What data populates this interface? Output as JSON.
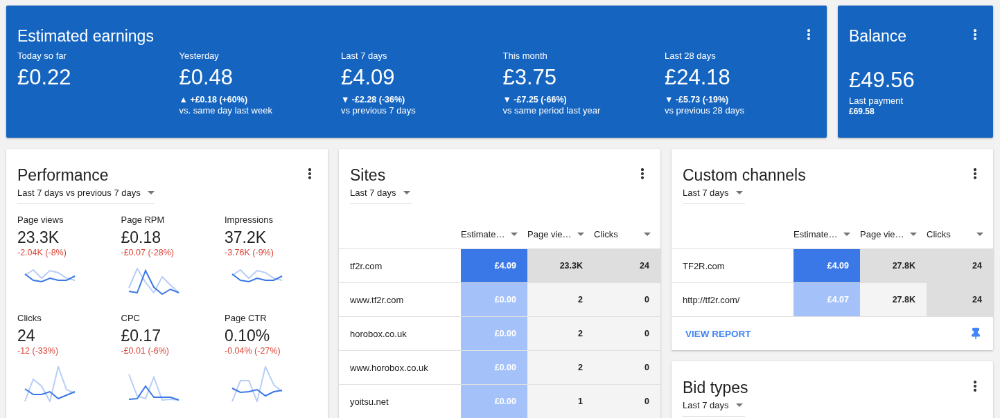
{
  "earnings": {
    "title": "Estimated earnings",
    "stats": [
      {
        "label": "Today so far",
        "value": "£0.22"
      },
      {
        "label": "Yesterday",
        "value": "£0.48",
        "change": "▲ +£0.18 (+60%)",
        "comparison": "vs. same day last week"
      },
      {
        "label": "Last 7 days",
        "value": "£4.09",
        "change": "▼ -£2.28 (-36%)",
        "comparison": "vs previous 7 days"
      },
      {
        "label": "This month",
        "value": "£3.75",
        "change": "▼ -£7.25 (-66%)",
        "comparison": "vs same period last year"
      },
      {
        "label": "Last 28 days",
        "value": "£24.18",
        "change": "▼ -£5.73 (-19%)",
        "comparison": "vs previous 28 days"
      }
    ]
  },
  "balance": {
    "title": "Balance",
    "value": "£49.56",
    "last_payment_label": "Last payment",
    "last_payment": "£69.58"
  },
  "performance": {
    "title": "Performance",
    "period": "Last 7 days vs previous 7 days",
    "metrics": [
      {
        "label": "Page views",
        "value": "23.3K",
        "change": "-2.04K (-8%)"
      },
      {
        "label": "Page RPM",
        "value": "£0.18",
        "change": "-£0.07 (-28%)"
      },
      {
        "label": "Impressions",
        "value": "37.2K",
        "change": "-3.76K (-9%)"
      },
      {
        "label": "Clicks",
        "value": "24",
        "change": "-12 (-33%)"
      },
      {
        "label": "CPC",
        "value": "£0.17",
        "change": "-£0.01 (-6%)"
      },
      {
        "label": "Page CTR",
        "value": "0.10%",
        "change": "-0.04% (-27%)"
      }
    ]
  },
  "sites": {
    "title": "Sites",
    "period": "Last 7 days",
    "columns": [
      "Estimate…",
      "Page vie…",
      "Clicks"
    ],
    "rows": [
      {
        "name": "tf2r.com",
        "cells": [
          {
            "text": "£4.09",
            "color": "#3b78e7"
          },
          {
            "text": "23.3K",
            "color": "#dedede"
          },
          {
            "text": "24",
            "color": "#dedede"
          }
        ]
      },
      {
        "name": "www.tf2r.com",
        "cells": [
          {
            "text": "£0.00",
            "color": "#a4c2f9"
          },
          {
            "text": "2",
            "color": "#f4f4f4"
          },
          {
            "text": "0",
            "color": "#f4f4f4"
          }
        ]
      },
      {
        "name": "horobox.co.uk",
        "cells": [
          {
            "text": "£0.00",
            "color": "#a4c2f9"
          },
          {
            "text": "2",
            "color": "#f4f4f4"
          },
          {
            "text": "0",
            "color": "#f4f4f4"
          }
        ]
      },
      {
        "name": "www.horobox.co.uk",
        "cells": [
          {
            "text": "£0.00",
            "color": "#a4c2f9"
          },
          {
            "text": "2",
            "color": "#f4f4f4"
          },
          {
            "text": "0",
            "color": "#f4f4f4"
          }
        ]
      },
      {
        "name": "yoitsu.net",
        "cells": [
          {
            "text": "£0.00",
            "color": "#a4c2f9"
          },
          {
            "text": "1",
            "color": "#f4f4f4"
          },
          {
            "text": "0",
            "color": "#f4f4f4"
          }
        ]
      }
    ]
  },
  "custom_channels": {
    "title": "Custom channels",
    "period": "Last 7 days",
    "columns": [
      "Estimate…",
      "Page vie…",
      "Clicks"
    ],
    "rows": [
      {
        "name": "TF2R.com",
        "cells": [
          {
            "text": "£4.09",
            "color": "#3b78e7"
          },
          {
            "text": "27.8K",
            "color": "#dedede"
          },
          {
            "text": "24",
            "color": "#dedede"
          }
        ]
      },
      {
        "name": "http://tf2r.com/",
        "cells": [
          {
            "text": "£4.07",
            "color": "#a4c2f9"
          },
          {
            "text": "27.8K",
            "color": "#f4f4f4"
          },
          {
            "text": "24",
            "color": "#dedede"
          }
        ]
      }
    ],
    "action": "VIEW REPORT"
  },
  "bid_types": {
    "title": "Bid types",
    "period": "Last 7 days"
  }
}
